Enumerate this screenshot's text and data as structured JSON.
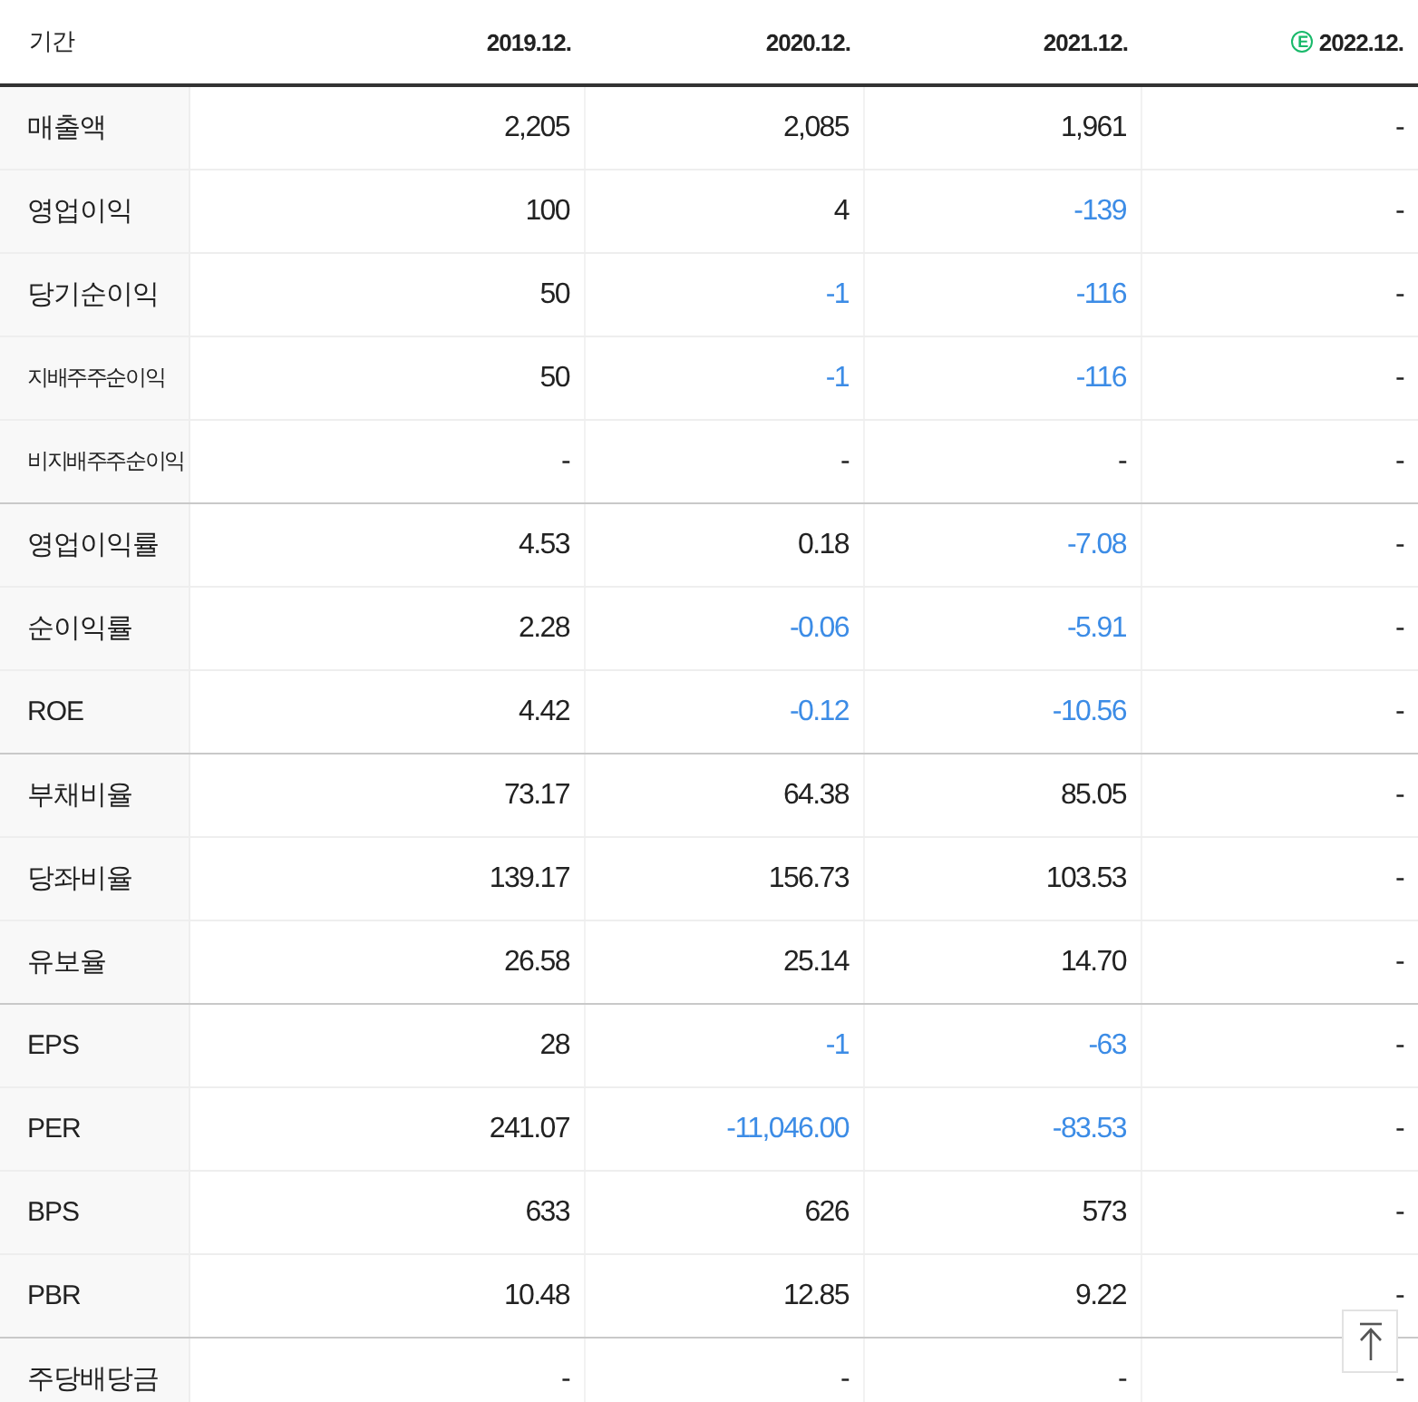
{
  "columns": [
    {
      "label": "기간"
    },
    {
      "label": "2019.12."
    },
    {
      "label": "2020.12."
    },
    {
      "label": "2021.12."
    },
    {
      "label": "2022.12.",
      "badge": "E"
    }
  ],
  "groups": [
    {
      "rows": [
        {
          "label": "매출액",
          "small": false,
          "cells": [
            {
              "text": "2,205",
              "negative": false
            },
            {
              "text": "2,085",
              "negative": false
            },
            {
              "text": "1,961",
              "negative": false
            },
            {
              "text": "-",
              "negative": false
            }
          ]
        },
        {
          "label": "영업이익",
          "small": false,
          "cells": [
            {
              "text": "100",
              "negative": false
            },
            {
              "text": "4",
              "negative": false
            },
            {
              "text": "-139",
              "negative": true
            },
            {
              "text": "-",
              "negative": false
            }
          ]
        },
        {
          "label": "당기순이익",
          "small": false,
          "cells": [
            {
              "text": "50",
              "negative": false
            },
            {
              "text": "-1",
              "negative": true
            },
            {
              "text": "-116",
              "negative": true
            },
            {
              "text": "-",
              "negative": false
            }
          ]
        },
        {
          "label": "지배주주순이익",
          "small": true,
          "cells": [
            {
              "text": "50",
              "negative": false
            },
            {
              "text": "-1",
              "negative": true
            },
            {
              "text": "-116",
              "negative": true
            },
            {
              "text": "-",
              "negative": false
            }
          ]
        },
        {
          "label": "비지배주주순이익",
          "small": true,
          "cells": [
            {
              "text": "-",
              "negative": false
            },
            {
              "text": "-",
              "negative": false
            },
            {
              "text": "-",
              "negative": false
            },
            {
              "text": "-",
              "negative": false
            }
          ]
        }
      ]
    },
    {
      "rows": [
        {
          "label": "영업이익률",
          "small": false,
          "cells": [
            {
              "text": "4.53",
              "negative": false
            },
            {
              "text": "0.18",
              "negative": false
            },
            {
              "text": "-7.08",
              "negative": true
            },
            {
              "text": "-",
              "negative": false
            }
          ]
        },
        {
          "label": "순이익률",
          "small": false,
          "cells": [
            {
              "text": "2.28",
              "negative": false
            },
            {
              "text": "-0.06",
              "negative": true
            },
            {
              "text": "-5.91",
              "negative": true
            },
            {
              "text": "-",
              "negative": false
            }
          ]
        },
        {
          "label": "ROE",
          "small": false,
          "cells": [
            {
              "text": "4.42",
              "negative": false
            },
            {
              "text": "-0.12",
              "negative": true
            },
            {
              "text": "-10.56",
              "negative": true
            },
            {
              "text": "-",
              "negative": false
            }
          ]
        }
      ]
    },
    {
      "rows": [
        {
          "label": "부채비율",
          "small": false,
          "cells": [
            {
              "text": "73.17",
              "negative": false
            },
            {
              "text": "64.38",
              "negative": false
            },
            {
              "text": "85.05",
              "negative": false
            },
            {
              "text": "-",
              "negative": false
            }
          ]
        },
        {
          "label": "당좌비율",
          "small": false,
          "cells": [
            {
              "text": "139.17",
              "negative": false
            },
            {
              "text": "156.73",
              "negative": false
            },
            {
              "text": "103.53",
              "negative": false
            },
            {
              "text": "-",
              "negative": false
            }
          ]
        },
        {
          "label": "유보율",
          "small": false,
          "cells": [
            {
              "text": "26.58",
              "negative": false
            },
            {
              "text": "25.14",
              "negative": false
            },
            {
              "text": "14.70",
              "negative": false
            },
            {
              "text": "-",
              "negative": false
            }
          ]
        }
      ]
    },
    {
      "rows": [
        {
          "label": "EPS",
          "small": false,
          "cells": [
            {
              "text": "28",
              "negative": false
            },
            {
              "text": "-1",
              "negative": true
            },
            {
              "text": "-63",
              "negative": true
            },
            {
              "text": "-",
              "negative": false
            }
          ]
        },
        {
          "label": "PER",
          "small": false,
          "cells": [
            {
              "text": "241.07",
              "negative": false
            },
            {
              "text": "-11,046.00",
              "negative": true
            },
            {
              "text": "-83.53",
              "negative": true
            },
            {
              "text": "-",
              "negative": false
            }
          ]
        },
        {
          "label": "BPS",
          "small": false,
          "cells": [
            {
              "text": "633",
              "negative": false
            },
            {
              "text": "626",
              "negative": false
            },
            {
              "text": "573",
              "negative": false
            },
            {
              "text": "-",
              "negative": false
            }
          ]
        },
        {
          "label": "PBR",
          "small": false,
          "cells": [
            {
              "text": "10.48",
              "negative": false
            },
            {
              "text": "12.85",
              "negative": false
            },
            {
              "text": "9.22",
              "negative": false
            },
            {
              "text": "-",
              "negative": false
            }
          ]
        }
      ]
    },
    {
      "rows": [
        {
          "label": "주당배당금",
          "small": false,
          "cells": [
            {
              "text": "-",
              "negative": false
            },
            {
              "text": "-",
              "negative": false
            },
            {
              "text": "-",
              "negative": false
            },
            {
              "text": "-",
              "negative": false
            }
          ]
        }
      ]
    }
  ]
}
